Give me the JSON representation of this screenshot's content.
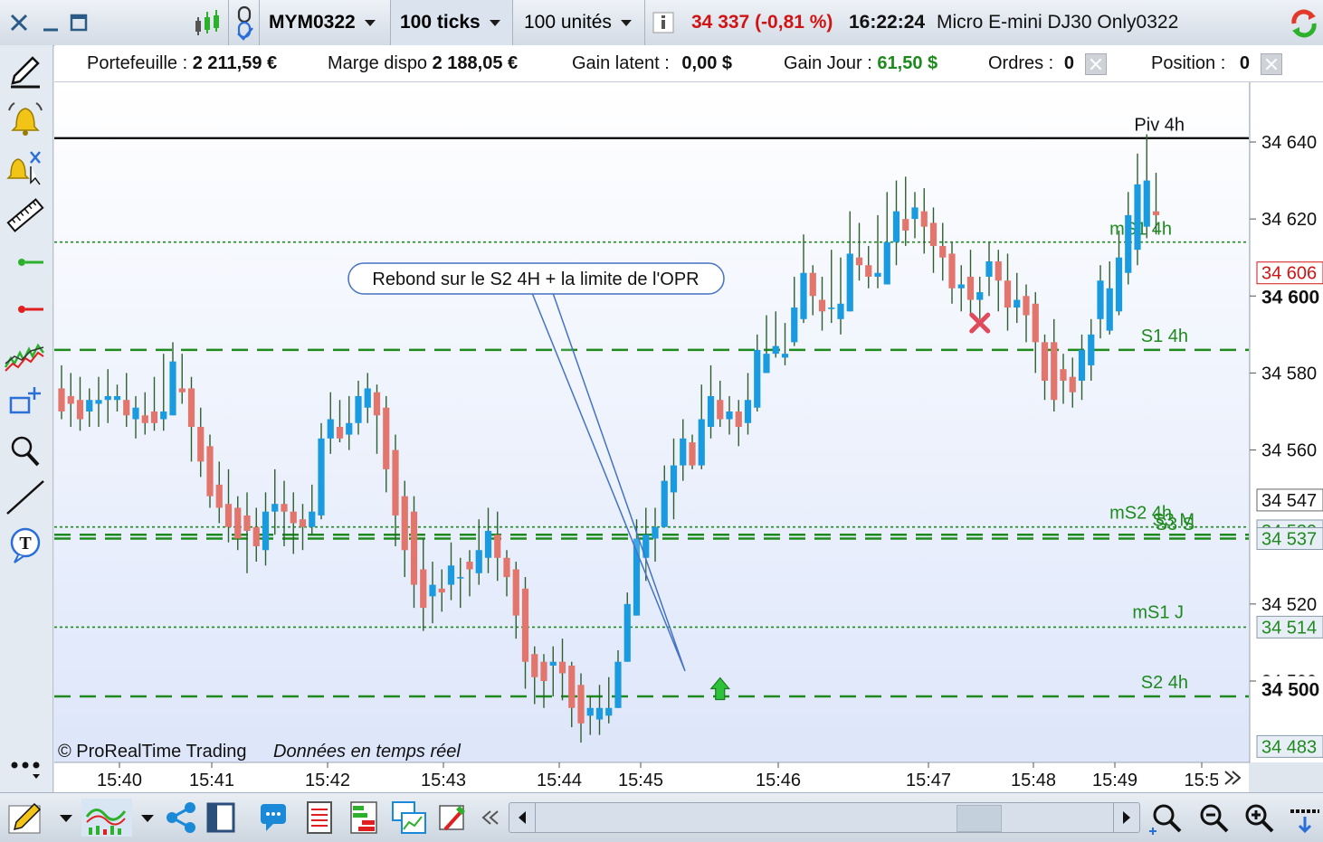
{
  "toolbar": {
    "symbol": "MYM0322",
    "interval": "100 ticks",
    "units": "100 unités",
    "price_change": "34 337 (-0,81 %)",
    "time": "16:22:24",
    "instrument": "Micro E-mini DJ30 Only0322"
  },
  "account": {
    "portefeuille_label": "Portefeuille :",
    "portefeuille_value": "2 211,59 €",
    "marge_label": "Marge dispo",
    "marge_value": "2 188,05 €",
    "gain_latent_label": "Gain latent :",
    "gain_latent_value": "0,00 $",
    "gain_jour_label": "Gain Jour :",
    "gain_jour_value": "61,50 $",
    "ordres_label": "Ordres :",
    "ordres_value": "0",
    "position_label": "Position :",
    "position_value": "0"
  },
  "colors": {
    "up": "#1a9be0",
    "down": "#e2756c",
    "level_green": "#1e8a1e",
    "negative_red": "#d01414",
    "positive_green": "#1e8a1e"
  },
  "chart_data": {
    "type": "candlestick",
    "copyright": "© ProRealTime Trading",
    "realtime": "Données en temps réel",
    "annotation": "Rebond sur le S2 4H + la limite de l'OPR",
    "y_ticks": [
      "34 640",
      "34 620",
      "34 600",
      "34 580",
      "34 560",
      "34 520",
      "34 500"
    ],
    "y_tick_values": [
      34640,
      34620,
      34600,
      34580,
      34560,
      34520,
      34500
    ],
    "x_ticks": [
      "15:40",
      "15:41",
      "15:42",
      "15:43",
      "15:44",
      "15:45",
      "15:46",
      "15:47",
      "15:48",
      "15:49",
      "15:5"
    ],
    "ylim": [
      34479,
      34656
    ],
    "levels": [
      {
        "name": "Piv 4h",
        "value": 34641,
        "style": "solid",
        "color": "#000000"
      },
      {
        "name": "mS1 4h",
        "value": 34614,
        "style": "dotted",
        "color": "#1e8a1e"
      },
      {
        "name": "S1 4h",
        "value": 34586,
        "style": "dashed",
        "color": "#1e8a1e"
      },
      {
        "name": "mS2 4h",
        "value": 34540,
        "style": "dotted",
        "color": "#1e8a1e"
      },
      {
        "name": "S3 S",
        "value": 34538,
        "style": "dashed",
        "color": "#1e8a1e"
      },
      {
        "name": "S3 M",
        "value": 34537,
        "style": "dashed",
        "color": "#1e8a1e"
      },
      {
        "name": "mS1 J",
        "value": 34514,
        "style": "dotted",
        "color": "#1e8a1e"
      },
      {
        "name": "S2 4h",
        "value": 34496,
        "style": "dashed",
        "color": "#1e8a1e"
      }
    ],
    "price_tags": [
      {
        "text": "34 606",
        "style": "current"
      },
      {
        "text": "34 547",
        "style": "box"
      },
      {
        "text": "34 539",
        "style": "green"
      },
      {
        "text": "34 537",
        "style": "green"
      },
      {
        "text": "34 514",
        "style": "green"
      },
      {
        "text": "34 483",
        "style": "green"
      }
    ],
    "price_tag_values": [
      34606,
      34547,
      34539,
      34537,
      34514,
      34483
    ],
    "bold_labels": [
      {
        "text": "34 600",
        "value": 34600
      },
      {
        "text": "34 500",
        "value": 34498
      }
    ],
    "markers": [
      {
        "type": "sell-cross",
        "index": 99,
        "value": 34593
      },
      {
        "type": "buy-arrow",
        "index": 71,
        "value": 34498
      }
    ],
    "candles": [
      [
        34576,
        34570,
        34582,
        34568
      ],
      [
        34574,
        34572,
        34580,
        34566
      ],
      [
        34573,
        34568,
        34579,
        34565
      ],
      [
        34570,
        34573,
        34576,
        34566
      ],
      [
        34572,
        34573,
        34579,
        34566
      ],
      [
        34573,
        34574,
        34581,
        34567
      ],
      [
        34573,
        34574,
        34577,
        34570
      ],
      [
        34573,
        34569,
        34580,
        34566
      ],
      [
        34568,
        34571,
        34574,
        34563
      ],
      [
        34569,
        34567,
        34575,
        34564
      ],
      [
        34570,
        34567,
        34579,
        34565
      ],
      [
        34568,
        34570,
        34585,
        34565
      ],
      [
        34569,
        34583,
        34588,
        34569
      ],
      [
        34576,
        34575,
        34585,
        34572
      ],
      [
        34576,
        34566,
        34579,
        34557
      ],
      [
        34566,
        34557,
        34571,
        34553
      ],
      [
        34561,
        34548,
        34564,
        34545
      ],
      [
        34551,
        34545,
        34557,
        34541
      ],
      [
        34546,
        34540,
        34555,
        34536
      ],
      [
        34545,
        34537,
        34548,
        34534
      ],
      [
        34543,
        34539,
        34549,
        34528
      ],
      [
        34540,
        34535,
        34545,
        34531
      ],
      [
        34534,
        34544,
        34549,
        34530
      ],
      [
        34544,
        34546,
        34555,
        34538
      ],
      [
        34546,
        34544,
        34552,
        34535
      ],
      [
        34544,
        34541,
        34549,
        34533
      ],
      [
        34542,
        34540,
        34546,
        34534
      ],
      [
        34540,
        34544,
        34551,
        34538
      ],
      [
        34543,
        34563,
        34567,
        34542
      ],
      [
        34563,
        34568,
        34575,
        34559
      ],
      [
        34566,
        34563,
        34573,
        34562
      ],
      [
        34564,
        34567,
        34574,
        34560
      ],
      [
        34567,
        34574,
        34578,
        34564
      ],
      [
        34571,
        34576,
        34580,
        34567
      ],
      [
        34575,
        34569,
        34577,
        34559
      ],
      [
        34571,
        34555,
        34574,
        34549
      ],
      [
        34560,
        34543,
        34564,
        34535
      ],
      [
        34548,
        34534,
        34552,
        34527
      ],
      [
        34544,
        34525,
        34548,
        34519
      ],
      [
        34529,
        34519,
        34537,
        34513
      ],
      [
        34522,
        34525,
        34531,
        34515
      ],
      [
        34524,
        34523,
        34529,
        34518
      ],
      [
        34525,
        34530,
        34536,
        34521
      ],
      [
        34527,
        34527,
        34532,
        34519
      ],
      [
        34531,
        34529,
        34534,
        34522
      ],
      [
        34528,
        34534,
        34542,
        34525
      ],
      [
        34532,
        34539,
        34545,
        34528
      ],
      [
        34538,
        34532,
        34544,
        34526
      ],
      [
        34532,
        34527,
        34534,
        34522
      ],
      [
        34529,
        34517,
        34531,
        34511
      ],
      [
        34524,
        34505,
        34527,
        34498
      ],
      [
        34507,
        34501,
        34509,
        34494
      ],
      [
        34505,
        34500,
        34507,
        34493
      ],
      [
        34504,
        34505,
        34509,
        34496
      ],
      [
        34505,
        34502,
        34511,
        34495
      ],
      [
        34504,
        34493,
        34505,
        34488
      ],
      [
        34499,
        34489,
        34502,
        34484
      ],
      [
        34491,
        34493,
        34496,
        34486
      ],
      [
        34490,
        34493,
        34499,
        34486
      ],
      [
        34491,
        34493,
        34501,
        34489
      ],
      [
        34493,
        34505,
        34508,
        34493
      ],
      [
        34505,
        34520,
        34523,
        34505
      ],
      [
        34517,
        34537,
        34542,
        34517
      ],
      [
        34532,
        34538,
        34545,
        34526
      ],
      [
        34537,
        34540,
        34545,
        34531
      ],
      [
        34540,
        34552,
        34556,
        34541
      ],
      [
        34549,
        34556,
        34563,
        34542
      ],
      [
        34556,
        34563,
        34568,
        34552
      ],
      [
        34562,
        34556,
        34564,
        34555
      ],
      [
        34556,
        34568,
        34577,
        34555
      ],
      [
        34566,
        34574,
        34582,
        34563
      ],
      [
        34573,
        34568,
        34578,
        34566
      ],
      [
        34568,
        34570,
        34574,
        34564
      ],
      [
        34570,
        34566,
        34573,
        34561
      ],
      [
        34567,
        34573,
        34580,
        34564
      ],
      [
        34571,
        34586,
        34590,
        34570
      ],
      [
        34580,
        34585,
        34595,
        34580
      ],
      [
        34585,
        34587,
        34596,
        34584
      ],
      [
        34584,
        34585,
        34593,
        34582
      ],
      [
        34588,
        34597,
        34605,
        34587
      ],
      [
        34594,
        34606,
        34616,
        34593
      ],
      [
        34606,
        34600,
        34608,
        34595
      ],
      [
        34599,
        34596,
        34605,
        34591
      ],
      [
        34597,
        34597,
        34612,
        34593
      ],
      [
        34594,
        34598,
        34610,
        34590
      ],
      [
        34596,
        34611,
        34622,
        34596
      ],
      [
        34610,
        34608,
        34619,
        34604
      ],
      [
        34608,
        34605,
        34613,
        34602
      ],
      [
        34605,
        34606,
        34621,
        34602
      ],
      [
        34603,
        34614,
        34627,
        34603
      ],
      [
        34614,
        34622,
        34630,
        34608
      ],
      [
        34620,
        34617,
        34631,
        34613
      ],
      [
        34620,
        34623,
        34627,
        34615
      ],
      [
        34622,
        34618,
        34628,
        34611
      ],
      [
        34619,
        34613,
        34623,
        34606
      ],
      [
        34613,
        34610,
        34619,
        34604
      ],
      [
        34611,
        34602,
        34614,
        34598
      ],
      [
        34602,
        34603,
        34608,
        34596
      ],
      [
        34605,
        34599,
        34612,
        34595
      ],
      [
        34599,
        34601,
        34605,
        34594
      ],
      [
        34605,
        34609,
        34614,
        34600
      ],
      [
        34609,
        34604,
        34612,
        34596
      ],
      [
        34604,
        34597,
        34611,
        34591
      ],
      [
        34597,
        34599,
        34606,
        34593
      ],
      [
        34600,
        34595,
        34603,
        34588
      ],
      [
        34598,
        34588,
        34601,
        34580
      ],
      [
        34588,
        34578,
        34590,
        34573
      ],
      [
        34588,
        34573,
        34594,
        34570
      ],
      [
        34581,
        34578,
        34585,
        34572
      ],
      [
        34579,
        34575,
        34584,
        34571
      ],
      [
        34578,
        34586,
        34590,
        34573
      ],
      [
        34582,
        34590,
        34594,
        34578
      ],
      [
        34594,
        34604,
        34608,
        34589
      ],
      [
        34591,
        34602,
        34609,
        34590
      ],
      [
        34596,
        34610,
        34617,
        34595
      ],
      [
        34606,
        34621,
        34627,
        34603
      ],
      [
        34612,
        34629,
        34637,
        34608
      ],
      [
        34618,
        34630,
        34642,
        34615
      ],
      [
        34622,
        34621,
        34632,
        34616
      ]
    ]
  },
  "left_tools": [
    "pencil-icon",
    "alert-bell-icon",
    "alert-edit-icon",
    "ruler-icon",
    "buy-level-icon",
    "sell-level-icon",
    "indicator-icon",
    "add-object-icon",
    "zoom-icon",
    "line-icon",
    "text-icon",
    "more-icon"
  ],
  "bottom_tools": [
    "pencil-tool-icon",
    "indicator-chart-icon",
    "share-icon",
    "layout-icon",
    "comment-icon",
    "report-icon",
    "orderbook-icon",
    "multi-chart-icon",
    "settings-icon"
  ]
}
